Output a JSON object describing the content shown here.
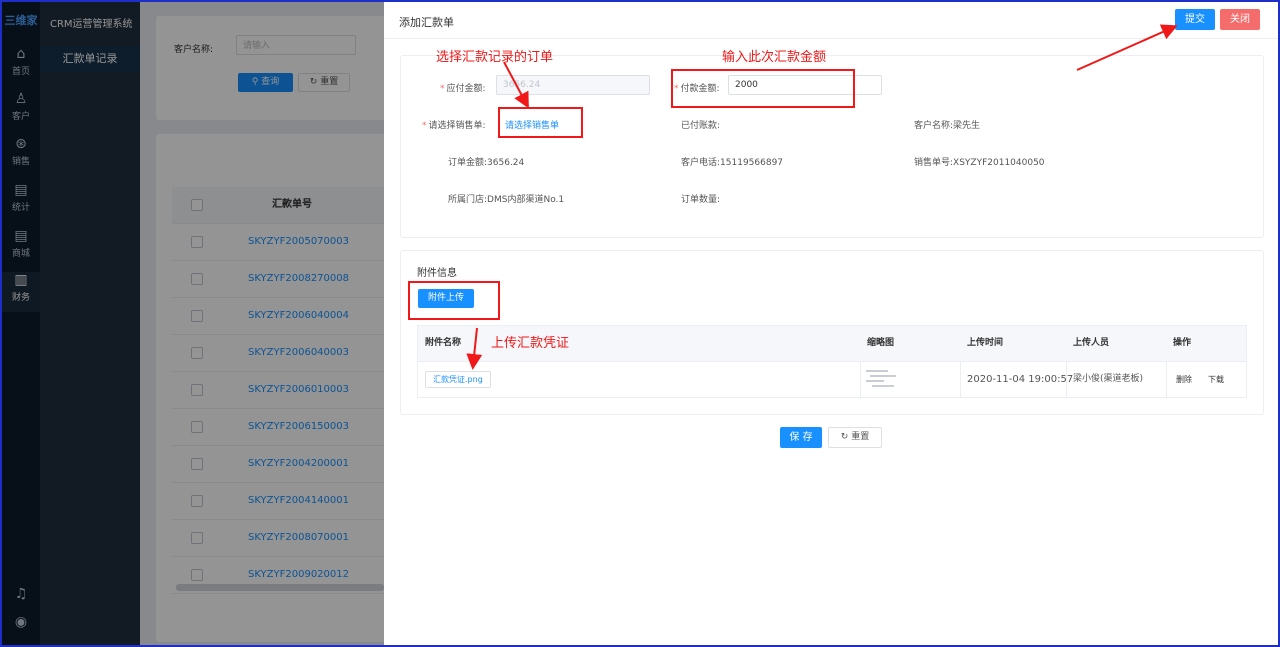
{
  "app": {
    "logo": "三维家",
    "system_title": "CRM运营管理系统",
    "rail": [
      {
        "icon": "home-icon",
        "label": "首页"
      },
      {
        "icon": "customer-icon",
        "label": "客户"
      },
      {
        "icon": "sales-icon",
        "label": "销售"
      },
      {
        "icon": "stats-icon",
        "label": "统计"
      },
      {
        "icon": "mall-icon",
        "label": "商城"
      },
      {
        "icon": "finance-icon",
        "label": "财务"
      }
    ],
    "sidebar_active": "汇款单记录"
  },
  "background_page": {
    "customer_name_label": "客户名称:",
    "customer_name_placeholder": "请输入",
    "query_label": "查询",
    "reset_label": "重置",
    "table_header": "汇款单号",
    "rows": [
      "SKYZYF2005070003",
      "SKYZYF2008270008",
      "SKYZYF2006040004",
      "SKYZYF2006040003",
      "SKYZYF2006010003",
      "SKYZYF2006150003",
      "SKYZYF2004200001",
      "SKYZYF2004140001",
      "SKYZYF2008070001",
      "SKYZYF2009020012"
    ]
  },
  "drawer": {
    "title": "添加汇款单",
    "submit_label": "提交",
    "close_label": "关闭",
    "form": {
      "payable_label": "应付金额:",
      "payable_value": "3656.24",
      "payment_label": "付款金额:",
      "payment_value": "2000",
      "select_order_label": "请选择销售单:",
      "select_order_link": "请选择销售单",
      "paid_label": "已付账款:",
      "customer_label": "客户名称:",
      "customer_value": "梁先生",
      "order_amount_label": "订单金额:",
      "order_amount_value": "3656.24",
      "phone_label": "客户电话:",
      "phone_value": "15119566897",
      "sales_no_label": "销售单号:",
      "sales_no_value": "XSYZYF2011040050",
      "store_label": "所属门店:",
      "store_value": "DMS内部渠道No.1",
      "qty_label": "订单数量:"
    },
    "attachments": {
      "section_title": "附件信息",
      "upload_label": "附件上传",
      "headers": [
        "附件名称",
        "缩略图",
        "上传时间",
        "上传人员",
        "操作"
      ],
      "file_name": "汇款凭证.png",
      "upload_time": "2020-11-04 19:00:57",
      "uploader": "梁小俊(渠道老板)",
      "delete_label": "删除",
      "download_label": "下载"
    },
    "save_label": "保 存",
    "reset_label": "重置"
  },
  "annotations": {
    "select_order": "选择汇款记录的订单",
    "enter_amount": "输入此次汇款金额",
    "upload_voucher": "上传汇款凭证"
  }
}
